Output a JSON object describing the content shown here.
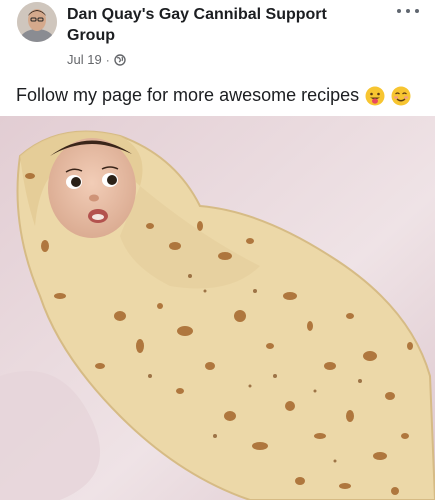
{
  "post": {
    "author": "Dan Quay's Gay Cannibal Support Group",
    "date": "Jul 19",
    "separator": "·",
    "privacy_icon": "globe-icon",
    "more_icon": "more-options-icon",
    "caption": "Follow my page for more awesome recipes",
    "caption_emojis": [
      "tongue-out-face-emoji",
      "smiling-blush-face-emoji"
    ],
    "photo_subject": "baby swaddled in flatbread"
  },
  "colors": {
    "author_text": "#1c1e21",
    "meta_text": "#65676b",
    "blanket_background": "#e8d9dd",
    "flatbread": "#ecd8a8",
    "flatbread_spots": "#a5672c"
  }
}
